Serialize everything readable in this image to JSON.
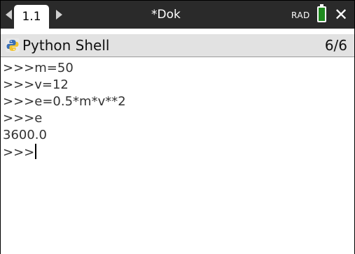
{
  "topbar": {
    "tab_label": "1.1",
    "document_title": "*Dok",
    "angle_mode": "RAD",
    "battery_icon": "battery-icon",
    "close_icon": "close-icon",
    "battery_color": "#1e8a1e"
  },
  "app": {
    "title": "Python Shell",
    "page_indicator": "6/6",
    "icon": "python-icon"
  },
  "shell": {
    "lines": [
      ">>>m=50",
      ">>>v=12",
      ">>>e=0.5*m*v**2",
      ">>>e",
      "3600.0",
      ">>>"
    ]
  }
}
